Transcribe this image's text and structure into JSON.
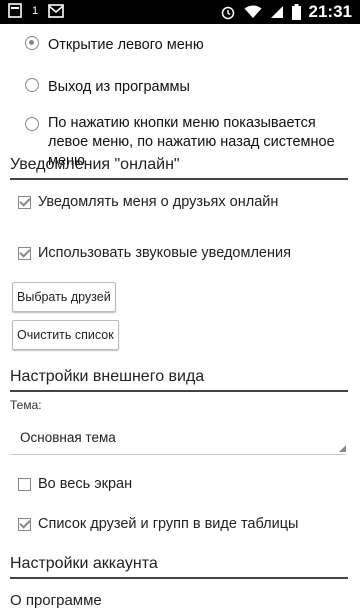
{
  "status_bar": {
    "left_number": "1",
    "time": "21:31",
    "icons": [
      "notification-icon",
      "mail-icon",
      "alarm-icon",
      "wifi-icon",
      "signal-icon",
      "battery-icon"
    ]
  },
  "menu_options": [
    {
      "label": "Открытие левого меню",
      "selected": true
    },
    {
      "label": "Выход из программы",
      "selected": false
    },
    {
      "label": "По нажатию кнопки меню показывается левое меню, по нажатию назад системное меню",
      "selected": false
    }
  ],
  "online_section": {
    "title": "Уведомления \"онлайн\"",
    "notify_friends_label": "Уведомлять меня о друзьях онлайн",
    "notify_friends_checked": true,
    "sound_label": "Использовать звуковые уведомления",
    "sound_checked": true,
    "select_friends_button": "Выбрать друзей",
    "clear_list_button": "Очистить список"
  },
  "appearance_section": {
    "title": "Настройки внешнего вида",
    "theme_label": "Тема:",
    "theme_value": "Основная тема",
    "fullscreen_label": "Во весь экран",
    "fullscreen_checked": false,
    "grid_label": "Список друзей и групп в виде таблицы",
    "grid_checked": true
  },
  "account_section": {
    "title": "Настройки аккаунта",
    "next_item_partial": "О программе"
  },
  "colors": {
    "status_bar": "#000000",
    "background": "#ffffff",
    "divider": "#444444"
  }
}
